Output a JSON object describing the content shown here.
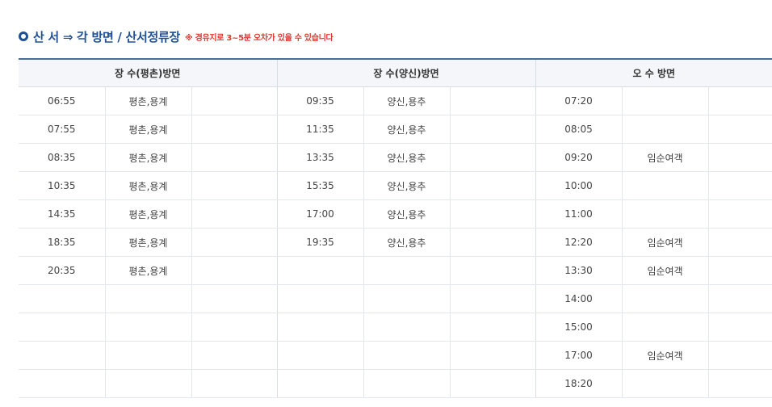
{
  "header": {
    "title": "산 서 ⇒ 각 방면 / 산서정류장",
    "note": "※ 경유지로 3~5분 오차가 있을 수 있습니다"
  },
  "timetable": {
    "groups": [
      {
        "label": "장 수(평촌)방면",
        "rows": [
          {
            "time": "06:55",
            "route": "평촌,용계",
            "extra": ""
          },
          {
            "time": "07:55",
            "route": "평촌,용계",
            "extra": ""
          },
          {
            "time": "08:35",
            "route": "평촌,용계",
            "extra": ""
          },
          {
            "time": "10:35",
            "route": "평촌,용계",
            "extra": ""
          },
          {
            "time": "14:35",
            "route": "평촌,용계",
            "extra": ""
          },
          {
            "time": "18:35",
            "route": "평촌,용계",
            "extra": ""
          },
          {
            "time": "20:35",
            "route": "평촌,용계",
            "extra": ""
          },
          {
            "time": "",
            "route": "",
            "extra": ""
          },
          {
            "time": "",
            "route": "",
            "extra": ""
          },
          {
            "time": "",
            "route": "",
            "extra": ""
          },
          {
            "time": "",
            "route": "",
            "extra": ""
          }
        ]
      },
      {
        "label": "장 수(양신)방면",
        "rows": [
          {
            "time": "09:35",
            "route": "양신,용추",
            "extra": ""
          },
          {
            "time": "11:35",
            "route": "양신,용추",
            "extra": ""
          },
          {
            "time": "13:35",
            "route": "양신,용추",
            "extra": ""
          },
          {
            "time": "15:35",
            "route": "양신,용추",
            "extra": ""
          },
          {
            "time": "17:00",
            "route": "양신,용추",
            "extra": ""
          },
          {
            "time": "19:35",
            "route": "양신,용추",
            "extra": ""
          },
          {
            "time": "",
            "route": "",
            "extra": ""
          },
          {
            "time": "",
            "route": "",
            "extra": ""
          },
          {
            "time": "",
            "route": "",
            "extra": ""
          },
          {
            "time": "",
            "route": "",
            "extra": ""
          },
          {
            "time": "",
            "route": "",
            "extra": ""
          }
        ]
      },
      {
        "label": "오 수 방면",
        "rows": [
          {
            "time": "07:20",
            "route": "",
            "extra": ""
          },
          {
            "time": "08:05",
            "route": "",
            "extra": ""
          },
          {
            "time": "09:20",
            "route": "임순여객",
            "extra": ""
          },
          {
            "time": "10:00",
            "route": "",
            "extra": ""
          },
          {
            "time": "11:00",
            "route": "",
            "extra": ""
          },
          {
            "time": "12:20",
            "route": "임순여객",
            "extra": ""
          },
          {
            "time": "13:30",
            "route": "임순여객",
            "extra": ""
          },
          {
            "time": "14:00",
            "route": "",
            "extra": ""
          },
          {
            "time": "15:00",
            "route": "",
            "extra": ""
          },
          {
            "time": "17:00",
            "route": "임순여객",
            "extra": ""
          },
          {
            "time": "18:20",
            "route": "",
            "extra": ""
          }
        ]
      }
    ]
  },
  "colors": {
    "title": "#1f4f96",
    "note": "#e0362f",
    "header_bg": "#f4f6fa",
    "top_border": "#4a6a9a"
  }
}
